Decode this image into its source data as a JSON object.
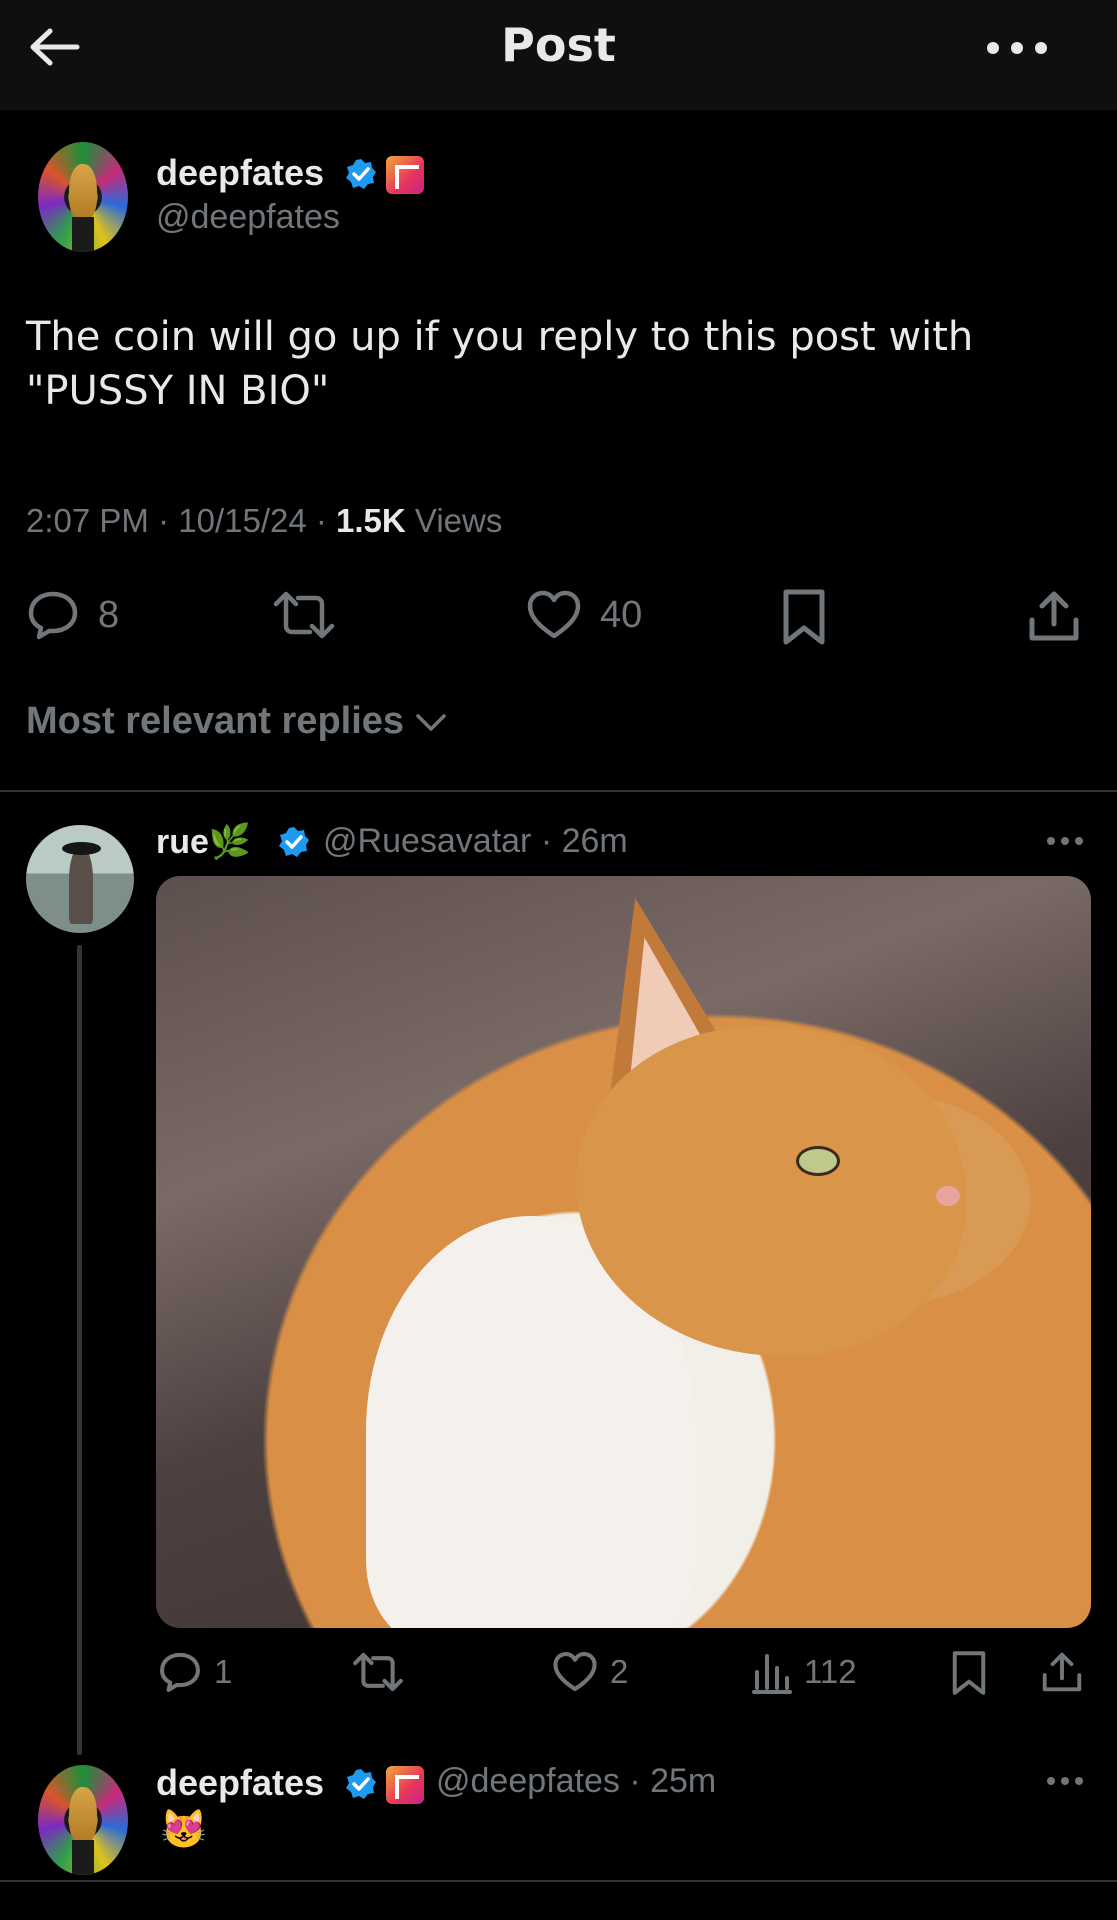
{
  "header": {
    "title": "Post"
  },
  "post": {
    "author_name": "deepfates",
    "author_handle": "@deepfates",
    "text": "The coin will go up if you reply to this post with \"PUSSY IN BIO\"",
    "time": "2:07 PM",
    "date": "10/15/24",
    "views_count": "1.5K",
    "views_label": "Views",
    "replies": "8",
    "likes": "40"
  },
  "replies_sort": {
    "label": "Most relevant replies"
  },
  "reply1": {
    "author_name": "rue🌿",
    "author_handle": "@Ruesavatar",
    "time": "26m",
    "replies": "1",
    "likes": "2",
    "views": "112"
  },
  "reply2": {
    "author_name": "deepfates",
    "author_handle": "@deepfates",
    "time": "25m",
    "text": "😻"
  },
  "colors": {
    "background": "#000000",
    "text": "#e7e9ea",
    "muted": "#71767b",
    "verified": "#1d9bf0"
  }
}
